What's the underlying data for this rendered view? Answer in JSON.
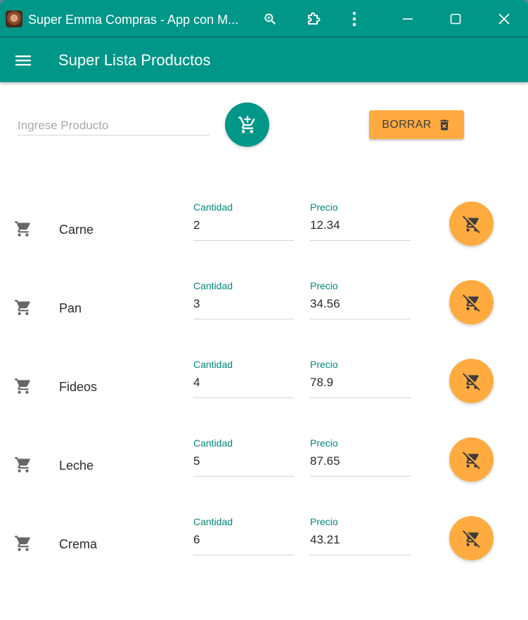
{
  "window": {
    "title": "Super Emma Compras - App con M..."
  },
  "toolbar": {
    "title": "Super Lista Productos"
  },
  "form": {
    "placeholder": "Ingrese Producto",
    "clear_label": "BORRAR"
  },
  "labels": {
    "quantity": "Cantidad",
    "price": "Precio"
  },
  "products": [
    {
      "name": "Carne",
      "quantity": "2",
      "price": "12.34"
    },
    {
      "name": "Pan",
      "quantity": "3",
      "price": "34.56"
    },
    {
      "name": "Fideos",
      "quantity": "4",
      "price": "78.9"
    },
    {
      "name": "Leche",
      "quantity": "5",
      "price": "87.65"
    },
    {
      "name": "Crema",
      "quantity": "6",
      "price": "43.21"
    }
  ],
  "colors": {
    "primary": "#009688",
    "accent": "#ffab40",
    "label": "#00897b"
  },
  "icons": {
    "menu": "menu-icon",
    "add_cart": "add-shopping-cart-icon",
    "delete": "delete-forever-icon",
    "cart": "shopping-cart-icon",
    "remove_cart": "remove-shopping-cart-icon"
  }
}
